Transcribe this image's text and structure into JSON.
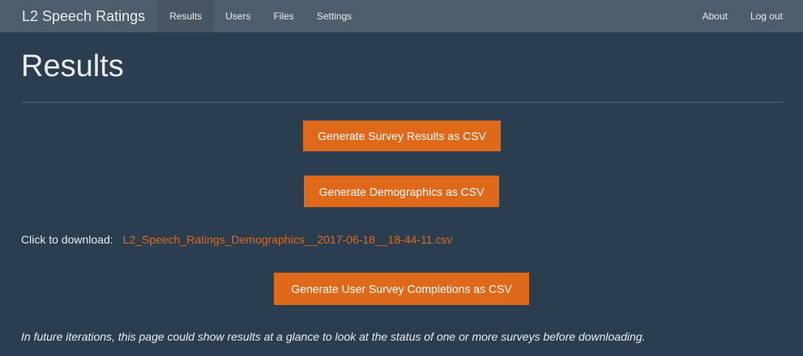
{
  "navbar": {
    "brand": "L2 Speech Ratings",
    "left_items": [
      {
        "label": "Results"
      },
      {
        "label": "Users"
      },
      {
        "label": "Files"
      },
      {
        "label": "Settings"
      }
    ],
    "right_items": [
      {
        "label": "About"
      },
      {
        "label": "Log out"
      }
    ],
    "active": "Results"
  },
  "main": {
    "title": "Results",
    "buttons": {
      "survey_results": "Generate Survey Results as CSV",
      "demographics": "Generate Demographics as CSV",
      "user_completions": "Generate User Survey Completions as CSV"
    },
    "download": {
      "label": "Click to download:",
      "filename": "L2_Speech_Ratings_Demographics__2017-06-18__18-44-11.csv"
    },
    "footnote": "In future iterations, this page could show results at a glance to look at the status of one or more surveys before downloading."
  },
  "colors": {
    "background": "#2b3e50",
    "navbar": "#4e5d6c",
    "accent": "#df691a",
    "text": "#ebebeb"
  }
}
